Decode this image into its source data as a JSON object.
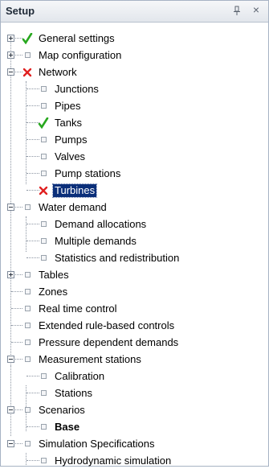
{
  "panel": {
    "title": "Setup",
    "pin_icon": "pin-icon",
    "close_glyph": "×"
  },
  "colors": {
    "check": "#28a81f",
    "cross": "#e02020",
    "selection": "#0b2f7a"
  },
  "tree": {
    "items": [
      {
        "label": "General settings",
        "icon": "check-icon",
        "expander": "plus"
      },
      {
        "label": "Map configuration",
        "icon": "box-icon",
        "expander": "plus"
      },
      {
        "label": "Network",
        "icon": "cross-icon",
        "expander": "minus"
      },
      {
        "label": "Junctions",
        "icon": "box-icon"
      },
      {
        "label": "Pipes",
        "icon": "box-icon"
      },
      {
        "label": "Tanks",
        "icon": "check-icon"
      },
      {
        "label": "Pumps",
        "icon": "box-icon"
      },
      {
        "label": "Valves",
        "icon": "box-icon"
      },
      {
        "label": "Pump stations",
        "icon": "box-icon"
      },
      {
        "label": "Turbines",
        "icon": "cross-icon",
        "selected": true
      },
      {
        "label": "Water demand",
        "icon": "box-icon",
        "expander": "minus"
      },
      {
        "label": "Demand allocations",
        "icon": "box-icon"
      },
      {
        "label": "Multiple demands",
        "icon": "box-icon"
      },
      {
        "label": "Statistics and redistribution",
        "icon": "box-icon"
      },
      {
        "label": "Tables",
        "icon": "box-icon",
        "expander": "plus"
      },
      {
        "label": "Zones",
        "icon": "box-icon"
      },
      {
        "label": "Real time control",
        "icon": "box-icon"
      },
      {
        "label": "Extended rule-based controls",
        "icon": "box-icon"
      },
      {
        "label": "Pressure dependent demands",
        "icon": "box-icon"
      },
      {
        "label": "Measurement stations",
        "icon": "box-icon",
        "expander": "minus"
      },
      {
        "label": "Calibration",
        "icon": "box-icon"
      },
      {
        "label": "Stations",
        "icon": "box-icon"
      },
      {
        "label": "Scenarios",
        "icon": "box-icon",
        "expander": "minus"
      },
      {
        "label": "Base",
        "icon": "box-icon",
        "bold": true
      },
      {
        "label": "Simulation Specifications",
        "icon": "box-icon",
        "expander": "minus"
      },
      {
        "label": "Hydrodynamic simulation",
        "icon": "box-icon"
      }
    ]
  }
}
